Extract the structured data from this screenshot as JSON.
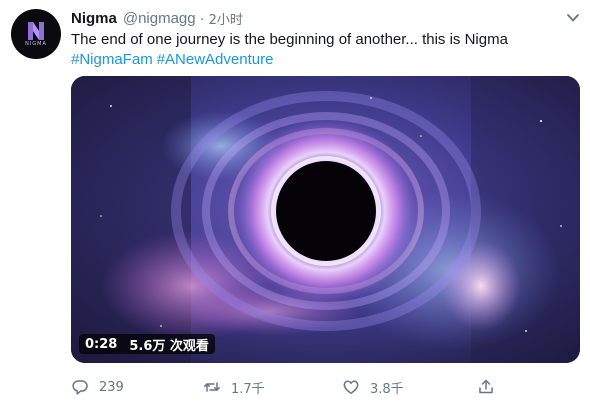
{
  "tweet": {
    "author": {
      "name": "Nigma",
      "handle": "@nigmagg",
      "separator": "·",
      "time": "2小时"
    },
    "avatar": {
      "logo_text": "NIGMA"
    },
    "text": {
      "body": "The end of one journey is the beginning of another... this is Nigma",
      "hashtags": [
        "#NigmaFam",
        "#ANewAdventure"
      ]
    },
    "media": {
      "duration": "0:28",
      "views": "5.6万 次观看"
    },
    "actions": {
      "replies": "239",
      "retweets": "1.7千",
      "likes": "3.8千"
    }
  },
  "colors": {
    "link": "#1b95e0",
    "muted": "#657786",
    "text": "#14171a"
  },
  "icons": [
    "chevron-down-icon",
    "reply-icon",
    "retweet-icon",
    "like-icon",
    "share-icon"
  ]
}
